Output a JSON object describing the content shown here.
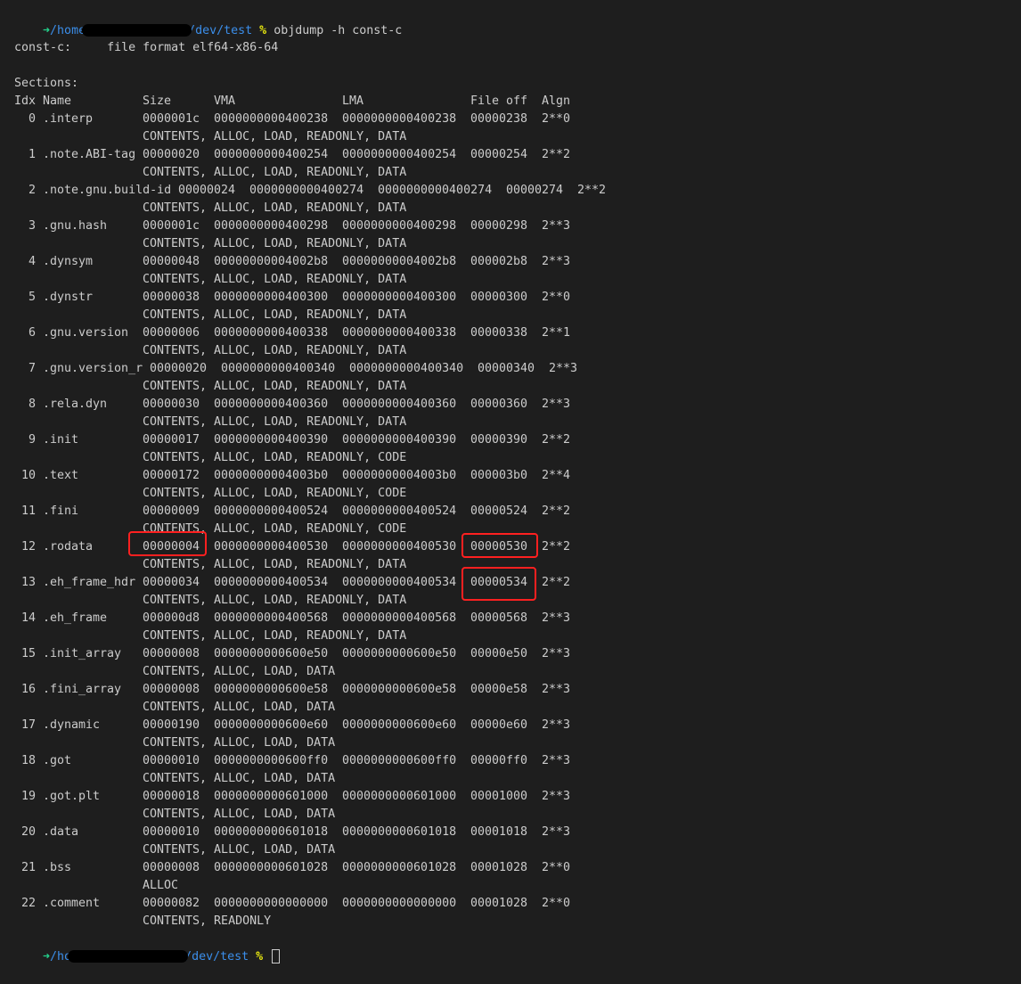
{
  "prompt1": {
    "arrow": "➜",
    "path_prefix": "/home",
    "path_suffix": "/dev/test",
    "symbol": "%",
    "command": "objdump -h const-c"
  },
  "file_line": "const-c:     file format elf64-x86-64",
  "sections_label": "Sections:",
  "header": [
    "Idx",
    "Name",
    "Size",
    "VMA",
    "LMA",
    "File off",
    "Algn"
  ],
  "rows": [
    {
      "idx": "0",
      "name": ".interp",
      "size": "0000001c",
      "vma": "0000000000400238",
      "lma": "0000000000400238",
      "off": "00000238",
      "algn": "2**0",
      "flags": "CONTENTS, ALLOC, LOAD, READONLY, DATA"
    },
    {
      "idx": "1",
      "name": ".note.ABI-tag",
      "size": "00000020",
      "vma": "0000000000400254",
      "lma": "0000000000400254",
      "off": "00000254",
      "algn": "2**2",
      "flags": "CONTENTS, ALLOC, LOAD, READONLY, DATA"
    },
    {
      "idx": "2",
      "name": ".note.gnu.build-id",
      "size": "00000024",
      "vma": "0000000000400274",
      "lma": "0000000000400274",
      "off": "00000274",
      "algn": "2**2",
      "flags": "CONTENTS, ALLOC, LOAD, READONLY, DATA"
    },
    {
      "idx": "3",
      "name": ".gnu.hash",
      "size": "0000001c",
      "vma": "0000000000400298",
      "lma": "0000000000400298",
      "off": "00000298",
      "algn": "2**3",
      "flags": "CONTENTS, ALLOC, LOAD, READONLY, DATA"
    },
    {
      "idx": "4",
      "name": ".dynsym",
      "size": "00000048",
      "vma": "00000000004002b8",
      "lma": "00000000004002b8",
      "off": "000002b8",
      "algn": "2**3",
      "flags": "CONTENTS, ALLOC, LOAD, READONLY, DATA"
    },
    {
      "idx": "5",
      "name": ".dynstr",
      "size": "00000038",
      "vma": "0000000000400300",
      "lma": "0000000000400300",
      "off": "00000300",
      "algn": "2**0",
      "flags": "CONTENTS, ALLOC, LOAD, READONLY, DATA"
    },
    {
      "idx": "6",
      "name": ".gnu.version",
      "size": "00000006",
      "vma": "0000000000400338",
      "lma": "0000000000400338",
      "off": "00000338",
      "algn": "2**1",
      "flags": "CONTENTS, ALLOC, LOAD, READONLY, DATA"
    },
    {
      "idx": "7",
      "name": ".gnu.version_r",
      "size": "00000020",
      "vma": "0000000000400340",
      "lma": "0000000000400340",
      "off": "00000340",
      "algn": "2**3",
      "flags": "CONTENTS, ALLOC, LOAD, READONLY, DATA"
    },
    {
      "idx": "8",
      "name": ".rela.dyn",
      "size": "00000030",
      "vma": "0000000000400360",
      "lma": "0000000000400360",
      "off": "00000360",
      "algn": "2**3",
      "flags": "CONTENTS, ALLOC, LOAD, READONLY, DATA"
    },
    {
      "idx": "9",
      "name": ".init",
      "size": "00000017",
      "vma": "0000000000400390",
      "lma": "0000000000400390",
      "off": "00000390",
      "algn": "2**2",
      "flags": "CONTENTS, ALLOC, LOAD, READONLY, CODE"
    },
    {
      "idx": "10",
      "name": ".text",
      "size": "00000172",
      "vma": "00000000004003b0",
      "lma": "00000000004003b0",
      "off": "000003b0",
      "algn": "2**4",
      "flags": "CONTENTS, ALLOC, LOAD, READONLY, CODE"
    },
    {
      "idx": "11",
      "name": ".fini",
      "size": "00000009",
      "vma": "0000000000400524",
      "lma": "0000000000400524",
      "off": "00000524",
      "algn": "2**2",
      "flags": "CONTENTS, ALLOC, LOAD, READONLY, CODE"
    },
    {
      "idx": "12",
      "name": ".rodata",
      "size": "00000004",
      "vma": "0000000000400530",
      "lma": "0000000000400530",
      "off": "00000530",
      "algn": "2**2",
      "flags": "CONTENTS, ALLOC, LOAD, READONLY, DATA"
    },
    {
      "idx": "13",
      "name": ".eh_frame_hdr",
      "size": "00000034",
      "vma": "0000000000400534",
      "lma": "0000000000400534",
      "off": "00000534",
      "algn": "2**2",
      "flags": "CONTENTS, ALLOC, LOAD, READONLY, DATA"
    },
    {
      "idx": "14",
      "name": ".eh_frame",
      "size": "000000d8",
      "vma": "0000000000400568",
      "lma": "0000000000400568",
      "off": "00000568",
      "algn": "2**3",
      "flags": "CONTENTS, ALLOC, LOAD, READONLY, DATA"
    },
    {
      "idx": "15",
      "name": ".init_array",
      "size": "00000008",
      "vma": "0000000000600e50",
      "lma": "0000000000600e50",
      "off": "00000e50",
      "algn": "2**3",
      "flags": "CONTENTS, ALLOC, LOAD, DATA"
    },
    {
      "idx": "16",
      "name": ".fini_array",
      "size": "00000008",
      "vma": "0000000000600e58",
      "lma": "0000000000600e58",
      "off": "00000e58",
      "algn": "2**3",
      "flags": "CONTENTS, ALLOC, LOAD, DATA"
    },
    {
      "idx": "17",
      "name": ".dynamic",
      "size": "00000190",
      "vma": "0000000000600e60",
      "lma": "0000000000600e60",
      "off": "00000e60",
      "algn": "2**3",
      "flags": "CONTENTS, ALLOC, LOAD, DATA"
    },
    {
      "idx": "18",
      "name": ".got",
      "size": "00000010",
      "vma": "0000000000600ff0",
      "lma": "0000000000600ff0",
      "off": "00000ff0",
      "algn": "2**3",
      "flags": "CONTENTS, ALLOC, LOAD, DATA"
    },
    {
      "idx": "19",
      "name": ".got.plt",
      "size": "00000018",
      "vma": "0000000000601000",
      "lma": "0000000000601000",
      "off": "00001000",
      "algn": "2**3",
      "flags": "CONTENTS, ALLOC, LOAD, DATA"
    },
    {
      "idx": "20",
      "name": ".data",
      "size": "00000010",
      "vma": "0000000000601018",
      "lma": "0000000000601018",
      "off": "00001018",
      "algn": "2**3",
      "flags": "CONTENTS, ALLOC, LOAD, DATA"
    },
    {
      "idx": "21",
      "name": ".bss",
      "size": "00000008",
      "vma": "0000000000601028",
      "lma": "0000000000601028",
      "off": "00001028",
      "algn": "2**0",
      "flags": "ALLOC"
    },
    {
      "idx": "22",
      "name": ".comment",
      "size": "00000082",
      "vma": "0000000000000000",
      "lma": "0000000000000000",
      "off": "00001028",
      "algn": "2**0",
      "flags": "CONTENTS, READONLY"
    }
  ],
  "prompt2": {
    "arrow": "➜",
    "path_prefix": "/ho",
    "path_suffix": "/dev/test",
    "symbol": "%"
  },
  "colors": {
    "background": "#1e1e1e",
    "text": "#cccccc",
    "prompt_arrow": "#23d18b",
    "path": "#3b8eea",
    "prompt_symbol": "#e5e510",
    "highlight_box": "#ff2020"
  }
}
